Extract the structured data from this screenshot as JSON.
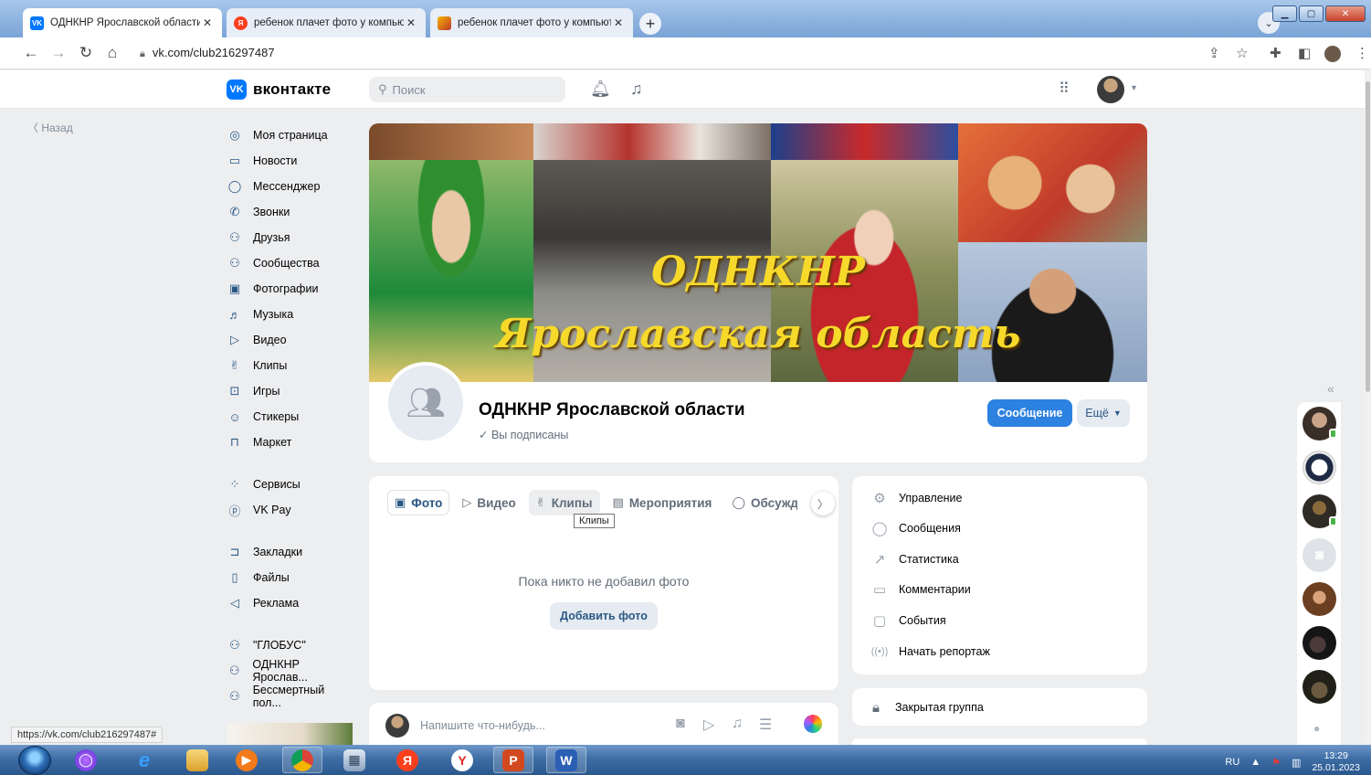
{
  "browser": {
    "tabs": [
      {
        "title": "ОДНКНР Ярославской области",
        "favicon": "vk-icon",
        "active": true
      },
      {
        "title": "ребенок плачет фото у компьютера",
        "favicon": "yandex-icon",
        "active": false
      },
      {
        "title": "ребенок плачет фото у компьютера",
        "favicon": "image-icon",
        "active": false
      }
    ],
    "url": "vk.com/club216297487",
    "status_url": "https://vk.com/club216297487#"
  },
  "vk": {
    "logo_text": "вконтакте",
    "search_placeholder": "Поиск",
    "back_label": "Назад"
  },
  "left_nav": {
    "groups": [
      [
        {
          "label": "Моя страница",
          "icon": "user-circle-icon"
        },
        {
          "label": "Новости",
          "icon": "news-icon"
        },
        {
          "label": "Мессенджер",
          "icon": "chat-bubble-icon"
        },
        {
          "label": "Звонки",
          "icon": "phone-icon"
        },
        {
          "label": "Друзья",
          "icon": "friends-icon"
        },
        {
          "label": "Сообщества",
          "icon": "communities-icon"
        },
        {
          "label": "Фотографии",
          "icon": "photo-icon"
        },
        {
          "label": "Музыка",
          "icon": "music-icon"
        },
        {
          "label": "Видео",
          "icon": "video-icon"
        },
        {
          "label": "Клипы",
          "icon": "clips-icon"
        },
        {
          "label": "Игры",
          "icon": "gamepad-icon"
        },
        {
          "label": "Стикеры",
          "icon": "smile-icon"
        },
        {
          "label": "Маркет",
          "icon": "bag-icon"
        }
      ],
      [
        {
          "label": "Сервисы",
          "icon": "services-icon"
        },
        {
          "label": "VK Pay",
          "icon": "vkpay-icon"
        }
      ],
      [
        {
          "label": "Закладки",
          "icon": "bookmark-icon"
        },
        {
          "label": "Файлы",
          "icon": "file-icon"
        },
        {
          "label": "Реклама",
          "icon": "megaphone-icon"
        }
      ],
      [
        {
          "label": "\"ГЛОБУС\"",
          "icon": "communities-icon"
        },
        {
          "label": "ОДНКНР Ярослав...",
          "icon": "communities-icon"
        },
        {
          "label": "Бессмертный пол...",
          "icon": "communities-icon"
        }
      ]
    ]
  },
  "cover": {
    "line1": "ОДНКНР",
    "line2": "Ярославская область"
  },
  "group": {
    "name": "ОДНКНР Ярославской области",
    "subscribed_label": "Вы подписаны",
    "message_button": "Сообщение",
    "more_button": "Ещё"
  },
  "media_tabs": {
    "items": [
      {
        "label": "Фото",
        "icon": "photo-icon",
        "selected": true
      },
      {
        "label": "Видео",
        "icon": "video-icon",
        "selected": false
      },
      {
        "label": "Клипы",
        "icon": "clips-icon",
        "selected": false
      },
      {
        "label": "Мероприятия",
        "icon": "calendar-icon",
        "selected": false
      },
      {
        "label": "Обсуждени",
        "icon": "chat-bubble-icon",
        "selected": false
      }
    ],
    "tooltip": "Клипы",
    "empty_text": "Пока никто не добавил фото",
    "add_button": "Добавить фото"
  },
  "management": {
    "items": [
      {
        "label": "Управление",
        "icon": "gear-icon"
      },
      {
        "label": "Сообщения",
        "icon": "chat-bubble-icon"
      },
      {
        "label": "Статистика",
        "icon": "chart-icon"
      },
      {
        "label": "Комментарии",
        "icon": "comment-icon"
      },
      {
        "label": "События",
        "icon": "events-icon"
      },
      {
        "label": "Начать репортаж",
        "icon": "broadcast-icon"
      }
    ],
    "closed_group": "Закрытая группа"
  },
  "composer": {
    "placeholder": "Напишите что-нибудь..."
  },
  "taskbar": {
    "lang": "RU",
    "time": "13:29",
    "date": "25.01.2023"
  },
  "colors": {
    "vk_blue": "#0077ff",
    "button_blue": "#2d81e0",
    "link": "#2a5885",
    "page_bg": "#edeef0",
    "cover_text": "#f6d92a",
    "online": "#4bb34b"
  }
}
